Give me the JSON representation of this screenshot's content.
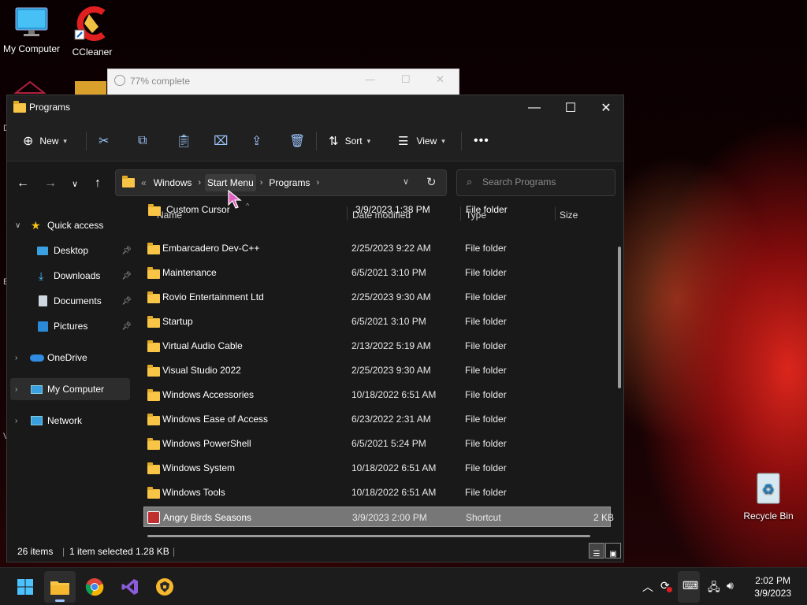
{
  "desktop": {
    "icons": [
      {
        "label": "My Computer",
        "icon": "monitor-icon"
      },
      {
        "label": "CCleaner",
        "icon": "ccleaner-icon"
      },
      {
        "label": "Recycle Bin",
        "icon": "recycle-bin-icon"
      }
    ]
  },
  "progress_window": {
    "title": "77% complete",
    "progress": 0.77
  },
  "explorer": {
    "title": "Programs",
    "toolbar": {
      "new_label": "New",
      "sort_label": "Sort",
      "view_label": "View",
      "icons": [
        "cut-icon",
        "copy-icon",
        "paste-icon",
        "rename-icon",
        "share-icon",
        "delete-icon",
        "more-icon"
      ]
    },
    "address": {
      "overflow": "«",
      "crumbs": [
        "Windows",
        "Start Menu",
        "Programs"
      ]
    },
    "search": {
      "placeholder": "Search Programs"
    },
    "nav": {
      "quick_access": "Quick access",
      "items": [
        {
          "label": "Desktop",
          "icon": "desktop-icon"
        },
        {
          "label": "Downloads",
          "icon": "downloads-icon"
        },
        {
          "label": "Documents",
          "icon": "documents-icon"
        },
        {
          "label": "Pictures",
          "icon": "pictures-icon"
        }
      ],
      "onedrive": "OneDrive",
      "my_computer": "My Computer",
      "network": "Network"
    },
    "columns": {
      "name": "Name",
      "date": "Date modified",
      "type": "Type",
      "size": "Size"
    },
    "files": [
      {
        "name": "Custom Cursor",
        "date": "3/9/2023 1:38 PM",
        "type": "File folder",
        "size": ""
      },
      {
        "name": "Embarcadero Dev-C++",
        "date": "2/25/2023 9:22 AM",
        "type": "File folder",
        "size": ""
      },
      {
        "name": "Maintenance",
        "date": "6/5/2021 3:10 PM",
        "type": "File folder",
        "size": ""
      },
      {
        "name": "Rovio Entertainment Ltd",
        "date": "2/25/2023 9:30 AM",
        "type": "File folder",
        "size": ""
      },
      {
        "name": "Startup",
        "date": "6/5/2021 3:10 PM",
        "type": "File folder",
        "size": ""
      },
      {
        "name": "Virtual Audio Cable",
        "date": "2/13/2022 5:19 AM",
        "type": "File folder",
        "size": ""
      },
      {
        "name": "Visual Studio 2022",
        "date": "2/25/2023 9:30 AM",
        "type": "File folder",
        "size": ""
      },
      {
        "name": "Windows Accessories",
        "date": "10/18/2022 6:51 AM",
        "type": "File folder",
        "size": ""
      },
      {
        "name": "Windows Ease of Access",
        "date": "6/23/2022 2:31 AM",
        "type": "File folder",
        "size": ""
      },
      {
        "name": "Windows PowerShell",
        "date": "6/5/2021 5:24 PM",
        "type": "File folder",
        "size": ""
      },
      {
        "name": "Windows System",
        "date": "10/18/2022 6:51 AM",
        "type": "File folder",
        "size": ""
      },
      {
        "name": "Windows Tools",
        "date": "10/18/2022 6:51 AM",
        "type": "File folder",
        "size": ""
      },
      {
        "name": "Angry Birds Seasons",
        "date": "3/9/2023 2:00 PM",
        "type": "Shortcut",
        "size": "2 KB"
      }
    ],
    "status": {
      "count": "26 items",
      "selection": "1 item selected  1.28 KB"
    }
  },
  "taskbar": {
    "apps": [
      "start-icon",
      "file-explorer-icon",
      "chrome-icon",
      "visual-studio-icon",
      "vpn-shield-icon"
    ],
    "tray": [
      "chevron-up-icon",
      "sync-icon",
      "keyboard-icon",
      "network-icon",
      "volume-icon"
    ],
    "time": "2:02 PM",
    "date": "3/9/2023"
  },
  "colors": {
    "accent": "#9ec7ff",
    "folder": "#f8c547",
    "selected_row": "#777777"
  }
}
